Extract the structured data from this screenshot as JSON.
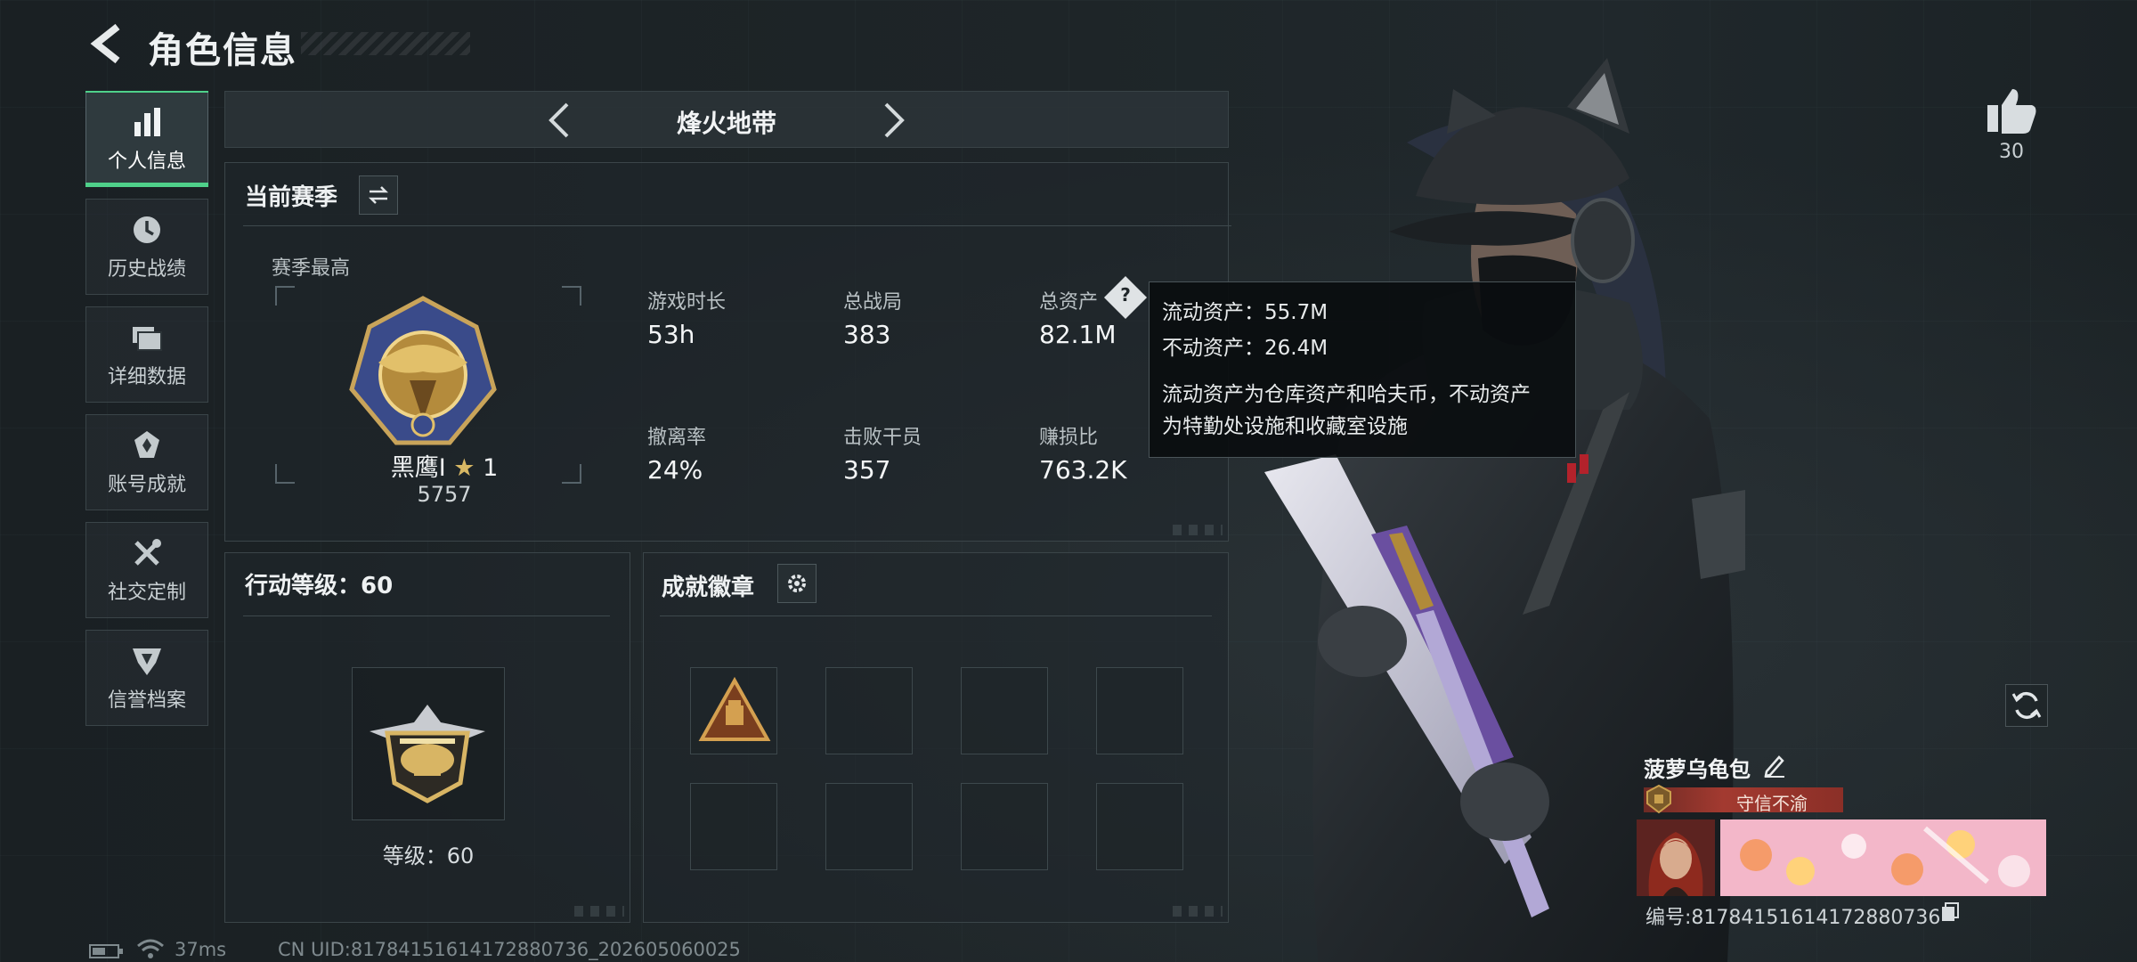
{
  "header": {
    "title": "角色信息"
  },
  "nav": {
    "items": [
      {
        "label": "个人信息",
        "icon": "bar-chart-icon",
        "active": true
      },
      {
        "label": "历史战绩",
        "icon": "history-clock-icon",
        "active": false
      },
      {
        "label": "详细数据",
        "icon": "cards-icon",
        "active": false
      },
      {
        "label": "账号成就",
        "icon": "achievement-icon",
        "active": false
      },
      {
        "label": "社交定制",
        "icon": "tools-icon",
        "active": false
      },
      {
        "label": "信誉档案",
        "icon": "credit-shield-icon",
        "active": false
      }
    ]
  },
  "season_bar": {
    "name": "烽火地带"
  },
  "season_panel": {
    "title": "当前赛季",
    "best_label": "赛季最高",
    "rank_name": "黑鹰Ⅰ",
    "rank_stars": "1",
    "rank_points": "5757",
    "stats": [
      {
        "label": "游戏时长",
        "value": "53h"
      },
      {
        "label": "总战局",
        "value": "383"
      },
      {
        "label": "总资产",
        "value": "82.1M"
      },
      {
        "label": "撤离率",
        "value": "24%"
      },
      {
        "label": "击败干员",
        "value": "357"
      },
      {
        "label": "赚损比",
        "value": "763.2K"
      }
    ],
    "help_icon": "?"
  },
  "tooltip": {
    "liquid": "流动资产：55.7M",
    "fixed": "不动资产：26.4M",
    "desc_line1": "流动资产为仓库资产和哈夫币，不动资产",
    "desc_line2": "为特勤处设施和收藏室设施"
  },
  "level_panel": {
    "title": "行动等级：60",
    "level_text": "等级：60"
  },
  "badge_panel": {
    "title": "成就徽章",
    "slots": 8,
    "filled_slots": 1
  },
  "player": {
    "likes": "30",
    "name": "菠萝乌龟包",
    "title": "守信不渝",
    "id_text": "编号:81784151614172880736"
  },
  "status": {
    "ping": "37ms",
    "uid": "CN UID:81784151614172880736_202605060025"
  },
  "colors": {
    "accent": "#4fd08a",
    "title_banner": "#a33a30"
  }
}
